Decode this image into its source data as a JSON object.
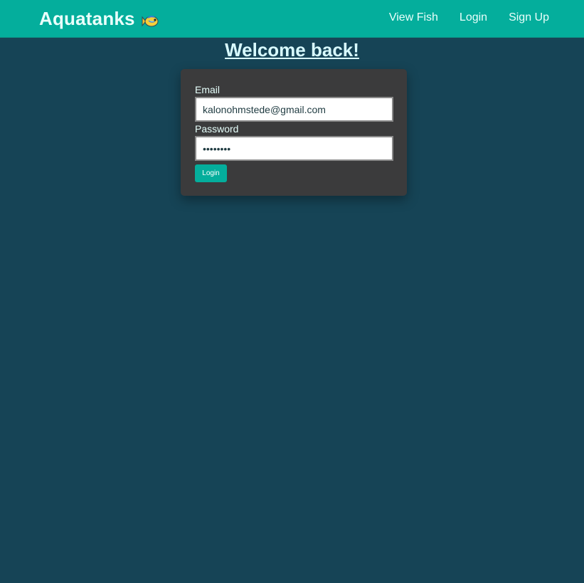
{
  "navbar": {
    "brand": "Aquatanks",
    "brand_icon": "fish-icon",
    "links": [
      {
        "label": "View Fish"
      },
      {
        "label": "Login"
      },
      {
        "label": "Sign Up"
      }
    ]
  },
  "page": {
    "heading": "Welcome back!"
  },
  "login_form": {
    "email_label": "Email",
    "email_value": "kalonohmstede@gmail.com",
    "password_label": "Password",
    "password_value": "password",
    "submit_label": "Login"
  },
  "colors": {
    "background": "#164456",
    "navbar": "#04ae9c",
    "card": "#3b3b3c",
    "accent": "#04ae9c"
  }
}
